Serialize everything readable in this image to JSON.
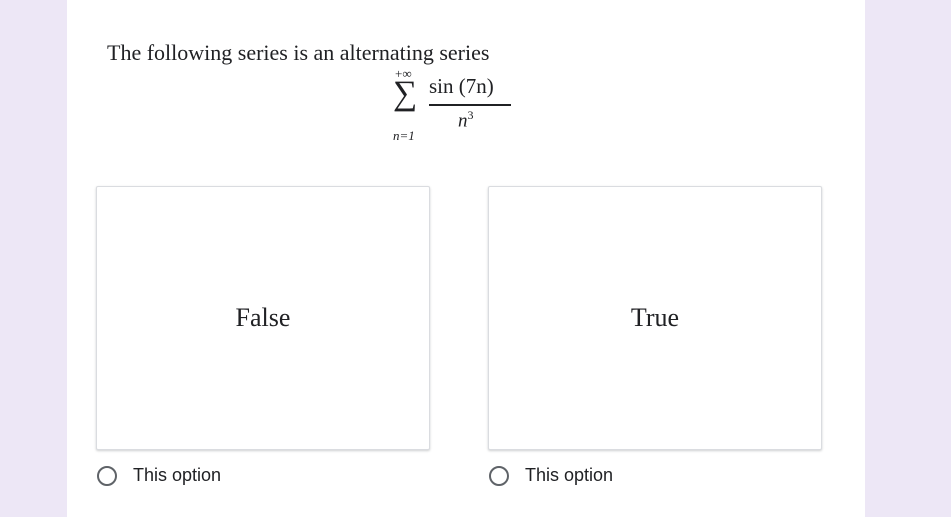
{
  "question": {
    "text": "The following series is an alternating series",
    "formula": {
      "upper": "+∞",
      "sigma": "∑",
      "lower": "n=1",
      "numerator": "sin (7n)",
      "denominator_base": "n",
      "denominator_exp": "3"
    }
  },
  "options": [
    {
      "text": "False",
      "radio_label": "This option"
    },
    {
      "text": "True",
      "radio_label": "This option"
    }
  ],
  "colors": {
    "page_background": "#ede7f6",
    "card_background": "#ffffff",
    "text": "#202124",
    "radio_border": "#5f6368"
  }
}
